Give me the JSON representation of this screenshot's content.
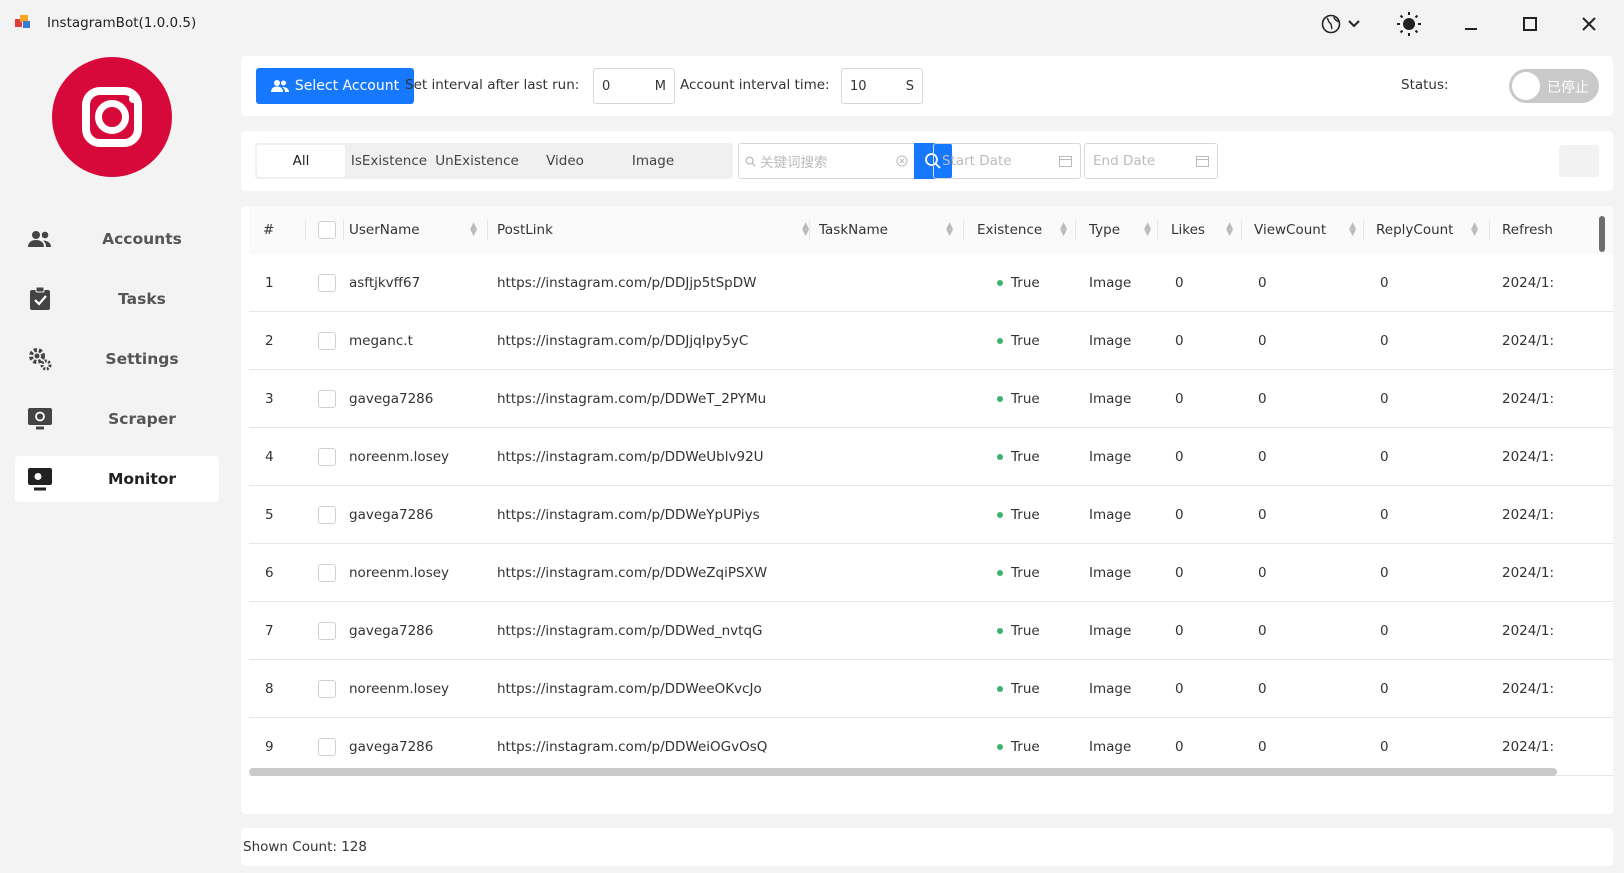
{
  "window": {
    "title": "InstagramBot(1.0.0.5)"
  },
  "sidebar": {
    "items": [
      {
        "label": "Accounts",
        "icon": "users-icon"
      },
      {
        "label": "Tasks",
        "icon": "clipboard-check-icon"
      },
      {
        "label": "Settings",
        "icon": "gear-icon"
      },
      {
        "label": "Scraper",
        "icon": "scraper-icon"
      },
      {
        "label": "Monitor",
        "icon": "monitor-icon"
      }
    ],
    "active": "Monitor"
  },
  "toolbar": {
    "select_account": "Select Account",
    "interval_label": "Set interval after last run:",
    "interval_value": "0",
    "interval_unit": "M",
    "account_interval_label": "Account interval time:",
    "account_interval_value": "10",
    "account_interval_unit": "S",
    "status_label": "Status:",
    "status_toggle_text": "已停止"
  },
  "filters": {
    "tabs": [
      "All",
      "IsExistence",
      "UnExistence",
      "Video",
      "Image"
    ],
    "active_tab": "All",
    "search_placeholder": "关键词搜索",
    "start_date_placeholder": "Start Date",
    "end_date_placeholder": "End Date"
  },
  "table": {
    "columns": [
      "#",
      "UserName",
      "PostLink",
      "TaskName",
      "Existence",
      "Type",
      "Likes",
      "ViewCount",
      "ReplyCount",
      "Refresh"
    ],
    "rows": [
      {
        "n": "1",
        "user": "asftjkvff67",
        "link": "https://instagram.com/p/DDJjp5tSpDW",
        "task": "",
        "existence": "True",
        "type": "Image",
        "likes": "0",
        "views": "0",
        "replies": "0",
        "refresh": "2024/1:"
      },
      {
        "n": "2",
        "user": "meganc.t",
        "link": "https://instagram.com/p/DDJjqIpy5yC",
        "task": "",
        "existence": "True",
        "type": "Image",
        "likes": "0",
        "views": "0",
        "replies": "0",
        "refresh": "2024/1:"
      },
      {
        "n": "3",
        "user": "gavega7286",
        "link": "https://instagram.com/p/DDWeT_2PYMu",
        "task": "",
        "existence": "True",
        "type": "Image",
        "likes": "0",
        "views": "0",
        "replies": "0",
        "refresh": "2024/1:"
      },
      {
        "n": "4",
        "user": "noreenm.losey",
        "link": "https://instagram.com/p/DDWeUblv92U",
        "task": "",
        "existence": "True",
        "type": "Image",
        "likes": "0",
        "views": "0",
        "replies": "0",
        "refresh": "2024/1:"
      },
      {
        "n": "5",
        "user": "gavega7286",
        "link": "https://instagram.com/p/DDWeYpUPiys",
        "task": "",
        "existence": "True",
        "type": "Image",
        "likes": "0",
        "views": "0",
        "replies": "0",
        "refresh": "2024/1:"
      },
      {
        "n": "6",
        "user": "noreenm.losey",
        "link": "https://instagram.com/p/DDWeZqiPSXW",
        "task": "",
        "existence": "True",
        "type": "Image",
        "likes": "0",
        "views": "0",
        "replies": "0",
        "refresh": "2024/1:"
      },
      {
        "n": "7",
        "user": "gavega7286",
        "link": "https://instagram.com/p/DDWed_nvtqG",
        "task": "",
        "existence": "True",
        "type": "Image",
        "likes": "0",
        "views": "0",
        "replies": "0",
        "refresh": "2024/1:"
      },
      {
        "n": "8",
        "user": "noreenm.losey",
        "link": "https://instagram.com/p/DDWeeOKvcJo",
        "task": "",
        "existence": "True",
        "type": "Image",
        "likes": "0",
        "views": "0",
        "replies": "0",
        "refresh": "2024/1:"
      },
      {
        "n": "9",
        "user": "gavega7286",
        "link": "https://instagram.com/p/DDWeiOGvOsQ",
        "task": "",
        "existence": "True",
        "type": "Image",
        "likes": "0",
        "views": "0",
        "replies": "0",
        "refresh": "2024/1:"
      }
    ]
  },
  "footer": {
    "shown_count": "Shown Count: 128"
  },
  "colors": {
    "accent": "#1677ff",
    "brand": "#d7093b",
    "success": "#3cb371"
  }
}
